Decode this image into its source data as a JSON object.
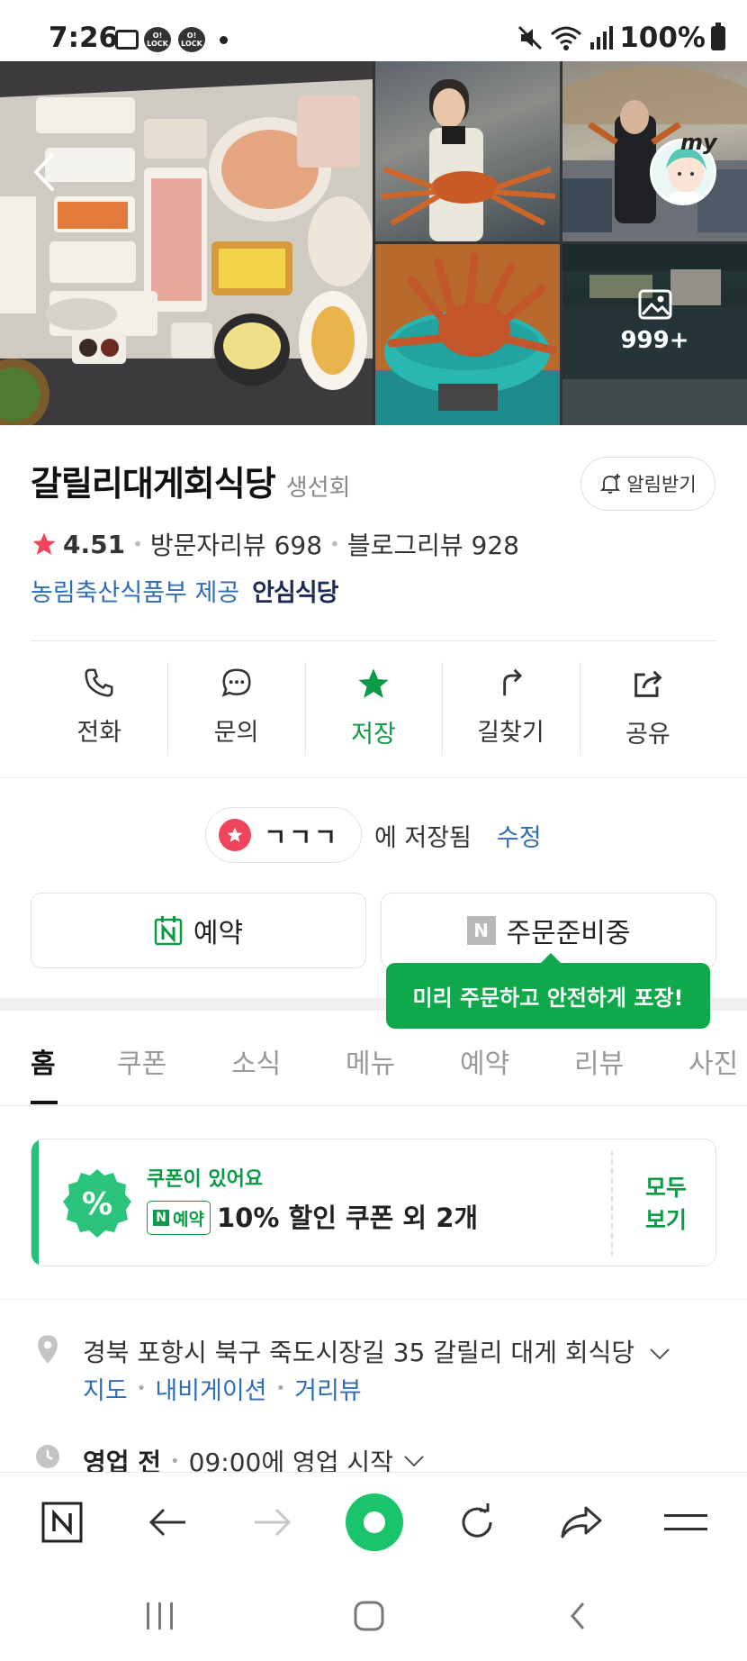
{
  "status_bar": {
    "time": "7:26",
    "notification_icons": [
      "gallery-icon",
      "olock-icon",
      "olock-icon",
      "dot-icon"
    ],
    "olock_label": "O!\nLOCK",
    "battery_text": "100%",
    "right_icons": [
      "mute-icon",
      "wifi-icon",
      "signal-icon",
      "battery-icon"
    ]
  },
  "photos": {
    "more_count": "999+",
    "my_label": "my"
  },
  "place": {
    "name": "갈릴리대게회식당",
    "category": "생선회",
    "alarm_label": "알림받기",
    "rating": "4.51",
    "visitor_reviews": "방문자리뷰 698",
    "blog_reviews": "블로그리뷰 928",
    "cert_text": "농림축산식품부 제공",
    "cert_badge": "안심식당"
  },
  "actions": [
    {
      "label": "전화",
      "icon": "phone-icon"
    },
    {
      "label": "문의",
      "icon": "chat-icon"
    },
    {
      "label": "저장",
      "icon": "star-icon",
      "active": true
    },
    {
      "label": "길찾기",
      "icon": "directions-icon"
    },
    {
      "label": "공유",
      "icon": "share-icon"
    }
  ],
  "saved": {
    "list_name": "ㄱㄱㄱ",
    "saved_text": "에 저장됨",
    "edit_label": "수정"
  },
  "booking": {
    "reserve_label": "예약",
    "order_label": "주문준비중",
    "tooltip": "미리 주문하고 안전하게 포장!"
  },
  "tabs": [
    "홈",
    "쿠폰",
    "소식",
    "메뉴",
    "예약",
    "리뷰",
    "사진"
  ],
  "active_tab": "홈",
  "coupon": {
    "subtitle": "쿠폰이 있어요",
    "tag": "예약",
    "main": "10% 할인 쿠폰 외 2개",
    "view_all": "모두\n보기"
  },
  "address": {
    "text": "경북 포항시 북구 죽도시장길 35 갈릴리 대게 회식당",
    "links": [
      "지도",
      "내비게이션",
      "거리뷰"
    ]
  },
  "hours": {
    "status": "영업 전",
    "detail": "09:00에 영업 시작"
  },
  "browser_bar": [
    "naver-home-icon",
    "back-arrow-icon",
    "forward-arrow-icon",
    "green-dot-icon",
    "refresh-icon",
    "share-arrow-icon",
    "menu-icon"
  ],
  "system_nav": [
    "recents-icon",
    "home-icon",
    "back-icon"
  ],
  "colors": {
    "accent_green": "#0b9a45",
    "link_blue": "#2f6db5",
    "star_red": "#f0435c",
    "tooltip_green": "#0fa84a"
  }
}
